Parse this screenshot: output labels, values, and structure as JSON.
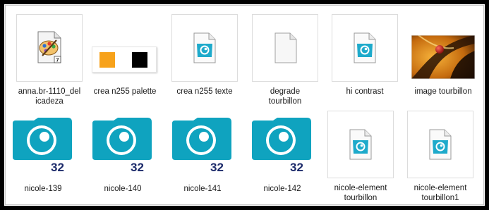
{
  "files": [
    {
      "name": "anna.br-1110_delicadeza",
      "label_line1": "anna.br-1110_del",
      "label_line2": "icadeza",
      "icon": "psp-tube-file-icon"
    },
    {
      "name": "crea n255 palette",
      "label_line1": "crea n255 palette",
      "label_line2": "",
      "icon": "color-palette-image-icon"
    },
    {
      "name": "crea n255 texte",
      "label_line1": "crea n255 texte",
      "label_line2": "",
      "icon": "image-document-icon"
    },
    {
      "name": "degrade tourbillon",
      "label_line1": "degrade",
      "label_line2": "tourbillon",
      "icon": "blank-document-icon"
    },
    {
      "name": "hi contrast",
      "label_line1": "hi contrast",
      "label_line2": "",
      "icon": "image-document-icon"
    },
    {
      "name": "image tourbillon",
      "label_line1": "image tourbillon",
      "label_line2": "",
      "icon": "photo-thumbnail-icon"
    },
    {
      "name": "nicole-139",
      "label_line1": "nicole-139",
      "label_line2": "",
      "icon": "camera-32-icon"
    },
    {
      "name": "nicole-140",
      "label_line1": "nicole-140",
      "label_line2": "",
      "icon": "camera-32-icon"
    },
    {
      "name": "nicole-141",
      "label_line1": "nicole-141",
      "label_line2": "",
      "icon": "camera-32-icon"
    },
    {
      "name": "nicole-142",
      "label_line1": "nicole-142",
      "label_line2": "",
      "icon": "camera-32-icon"
    },
    {
      "name": "nicole-element tourbillon",
      "label_line1": "nicole-element",
      "label_line2": "tourbillon",
      "icon": "image-document-icon"
    },
    {
      "name": "nicole-element tourbillon1",
      "label_line1": "nicole-element",
      "label_line2": "tourbillon1",
      "icon": "image-document-icon"
    }
  ],
  "badge": "32",
  "colors": {
    "camera_teal": "#0fa3bf",
    "badge_navy": "#1c2a6a",
    "palette_orange": "#f7a21b",
    "palette_black": "#000000",
    "frame": "#000000"
  }
}
